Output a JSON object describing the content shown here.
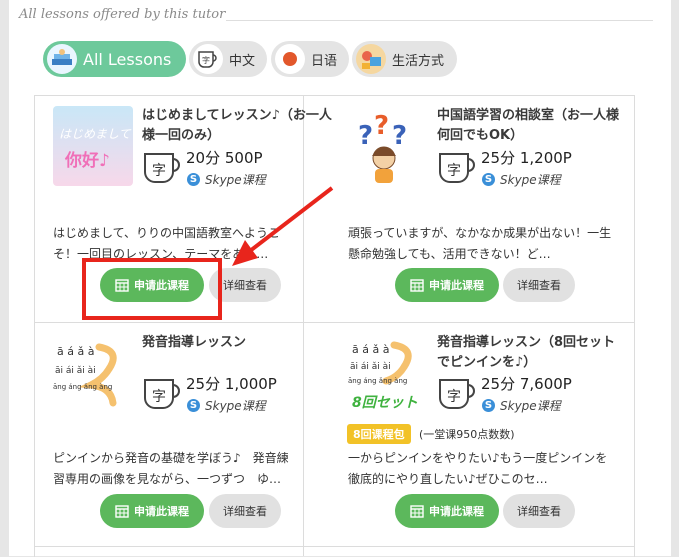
{
  "section": {
    "title": "All lessons offered by this tutor"
  },
  "filters": [
    {
      "label": "All Lessons",
      "icon": "books-icon",
      "active": true
    },
    {
      "label": "中文",
      "icon": "chinese-cup-icon",
      "active": false
    },
    {
      "label": "日语",
      "icon": "japan-flag-icon",
      "active": false
    },
    {
      "label": "生活方式",
      "icon": "lifestyle-icon",
      "active": false
    }
  ],
  "lessons": [
    {
      "title": "はじめましてレッスン♪（お一人様一回のみ）",
      "thumb_text": "你好♪",
      "duration_price": "20分 500P",
      "platform": "Skype课程",
      "description": "はじめまして、りりの中国語教室へようこそ！一回目のレッスン、テーマをあら…",
      "apply_label": "申请此课程",
      "detail_label": "详细查看"
    },
    {
      "title": "中国語学習の相談室（お一人様何回でもOK）",
      "duration_price": "25分 1,200P",
      "platform": "Skype课程",
      "description": "頑張っていますが、なかなか成果が出ない！一生懸命勉強しても、活用できない！ど…",
      "apply_label": "申请此课程",
      "detail_label": "详细查看"
    },
    {
      "title": "発音指導レッスン",
      "thumb_text": [
        "ā á ǎ à",
        "āi ái ǎi ài",
        "āng áng ǎng àng"
      ],
      "duration_price": "25分 1,000P",
      "platform": "Skype课程",
      "description": "ピンインから発音の基礎を学ぼう♪　発音練習専用の画像を見ながら、一つずつ　ゆ…",
      "apply_label": "申请此课程",
      "detail_label": "详细查看"
    },
    {
      "title": "発音指導レッスン（8回セットでピンインを♪）",
      "thumb_text": [
        "ā á ǎ à",
        "āi ái ǎi ài",
        "āng áng ǎng àng",
        "8回セット"
      ],
      "duration_price": "25分 7,600P",
      "platform": "Skype课程",
      "package_badge": "8回课程包",
      "package_note": "(一堂课950点数数)",
      "description": "一からピンインをやりたい♪もう一度ピンインを徹底的にやり直したい♪ぜひこのセ…",
      "apply_label": "申请此课程",
      "detail_label": "详细查看"
    }
  ],
  "colors": {
    "accent_green": "#5cb85c",
    "chip_active": "#6dc99b",
    "annotation_red": "#e8251c",
    "badge_yellow": "#f2c227"
  }
}
